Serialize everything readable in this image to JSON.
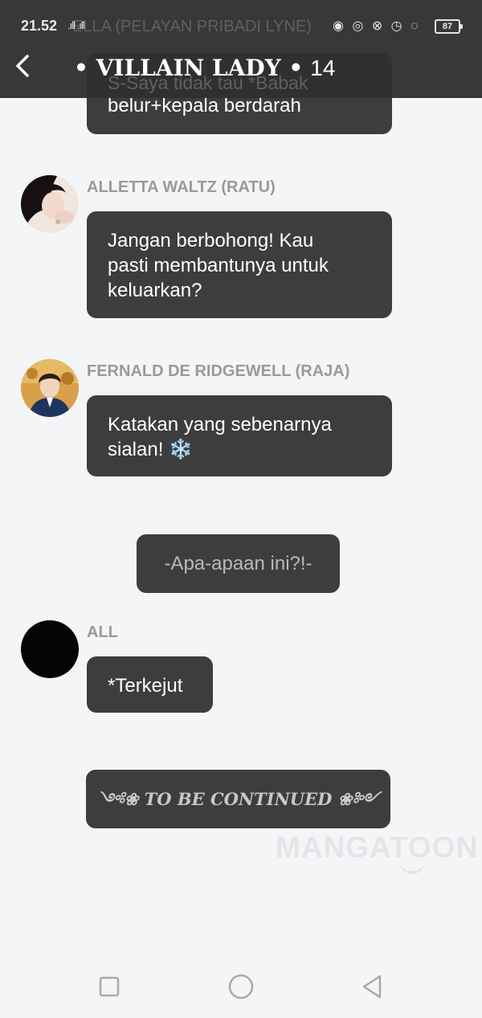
{
  "status_bar": {
    "time": "21.52",
    "signal": ".ıll .ıll",
    "icons": "◉ ◎ ⊗ ◷ ◌",
    "battery": "87"
  },
  "header": {
    "overlay_speaker": "ELLA (PELAYAN PRIBADI LYNE)",
    "overlay_text": "S-Saya tidak tau *Babak",
    "title_main": "• VILLAIN LADY •",
    "title_num": "14"
  },
  "messages": [
    {
      "text": "belur+kepala berdarah"
    },
    {
      "speaker": "ALLETTA WALTZ (RATU)",
      "lines": [
        "Jangan berbohong! Kau",
        "pasti membantunya untuk",
        "keluarkan?"
      ]
    },
    {
      "speaker": "FERNALD DE RIDGEWELL (RAJA)",
      "lines": [
        "Katakan yang sebenarnya",
        "sialan! ❄️"
      ]
    },
    {
      "narration": "-Apa-apaan ini?!-"
    },
    {
      "speaker": "ALL",
      "text": "*Terkejut"
    },
    {
      "narration": "༺❀ TO BE CONTINUED ❀༻"
    }
  ],
  "watermark": "MANGATOON",
  "colors": {
    "background": "#f4f5f7",
    "bubble": "#3d3d3d",
    "bubble_text": "#ffffff",
    "speaker_name": "#9a9a9a",
    "header": "#303030"
  },
  "icons": {
    "back": "chevron-left-icon",
    "nav_recent": "square-icon",
    "nav_home": "circle-icon",
    "nav_back": "triangle-back-icon"
  }
}
